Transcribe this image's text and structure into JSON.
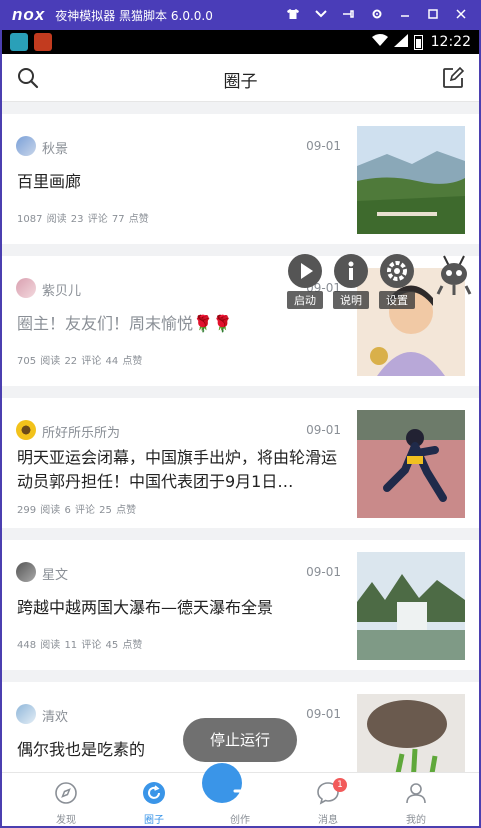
{
  "emulator": {
    "logo": "nox",
    "title": "夜神模拟器 黑猫脚本 6.0.0.0",
    "controls": [
      "shirt-icon",
      "chevron-down-icon",
      "pin-icon",
      "gear-icon",
      "minimize-icon",
      "maximize-icon",
      "close-icon"
    ]
  },
  "statusbar": {
    "time": "12:22"
  },
  "header": {
    "title": "圈子"
  },
  "posts": [
    {
      "author": "秋景",
      "date": "09-01",
      "title": "百里画廊",
      "stats": "1087 阅读 23 评论 77 点赞",
      "muted": false
    },
    {
      "author": "紫贝儿",
      "date": "09-01",
      "title": "圈主！友友们！周末愉悦🌹🌹",
      "stats": "705 阅读 22 评论 44 点赞",
      "muted": true
    },
    {
      "author": "所好所乐所为",
      "date": "09-01",
      "title": "明天亚运会闭幕，中国旗手出炉，将由轮滑运动员郭丹担任！中国代表团于9月1日…",
      "stats": "299 阅读 6 评论 25 点赞",
      "muted": false
    },
    {
      "author": "星文",
      "date": "09-01",
      "title": "跨越中越两国大瀑布—德天瀑布全景",
      "stats": "448 阅读 11 评论 45 点赞",
      "muted": false
    },
    {
      "author": "清欢",
      "date": "09-01",
      "title": "偶尔我也是吃素的",
      "stats": "",
      "muted": false
    }
  ],
  "overlay": {
    "buttons": [
      {
        "label": "启动",
        "icon": "play-icon"
      },
      {
        "label": "说明",
        "icon": "info-icon"
      },
      {
        "label": "设置",
        "icon": "gear-icon"
      }
    ],
    "mascot": "ant-icon",
    "stop_label": "停止运行"
  },
  "tabbar": {
    "tabs": [
      {
        "label": "发现",
        "icon": "compass-icon",
        "active": false
      },
      {
        "label": "圈子",
        "icon": "circle-icon",
        "active": true
      },
      {
        "label": "创作",
        "icon": "plus-icon",
        "active": false
      },
      {
        "label": "消息",
        "icon": "chat-icon",
        "active": false,
        "badge": "1"
      },
      {
        "label": "我的",
        "icon": "user-icon",
        "active": false
      }
    ]
  },
  "colors": {
    "accent": "#3a95e8",
    "emulator_bar": "#4a3db8",
    "badge": "#f25a5a"
  }
}
